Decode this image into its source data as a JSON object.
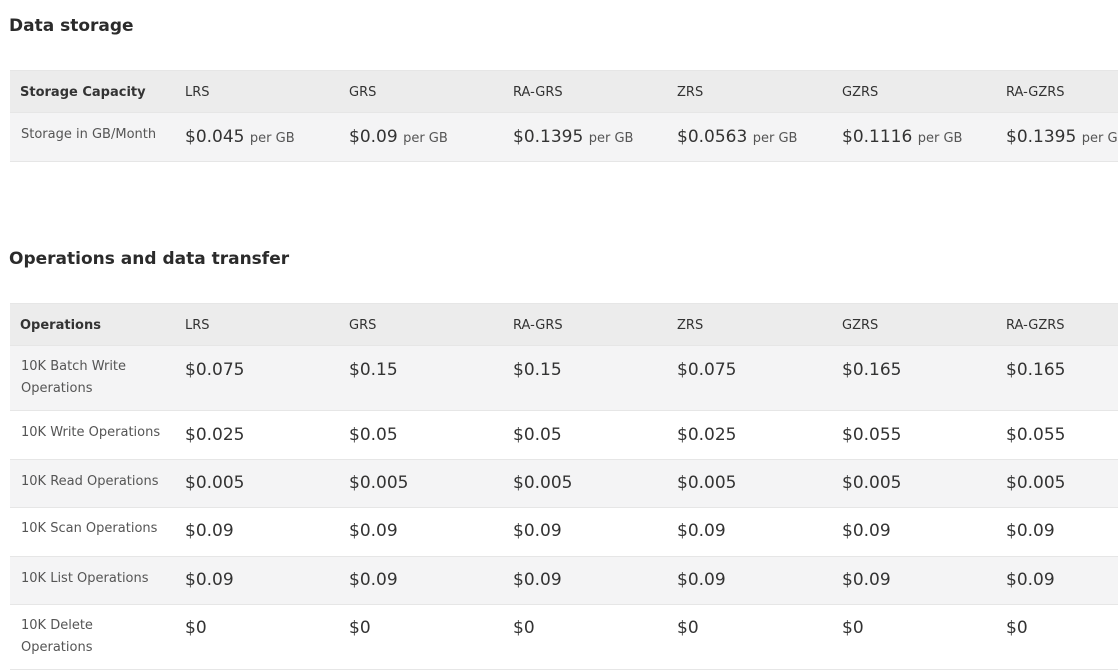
{
  "data_storage": {
    "title": "Data storage",
    "header": [
      "Storage Capacity",
      "LRS",
      "GRS",
      "RA-GRS",
      "ZRS",
      "GZRS",
      "RA-GZRS"
    ],
    "row": {
      "label": "Storage in GB/Month",
      "prices": [
        "$0.045",
        "$0.09",
        "$0.1395",
        "$0.0563",
        "$0.1116",
        "$0.1395"
      ],
      "unit": "per GB"
    }
  },
  "operations": {
    "title": "Operations and data transfer",
    "header": [
      "Operations",
      "LRS",
      "GRS",
      "RA-GRS",
      "ZRS",
      "GZRS",
      "RA-GZRS"
    ],
    "rows": [
      {
        "label": "10K Batch Write Operations",
        "values": [
          "$0.075",
          "$0.15",
          "$0.15",
          "$0.075",
          "$0.165",
          "$0.165"
        ]
      },
      {
        "label": "10K Write Operations",
        "values": [
          "$0.025",
          "$0.05",
          "$0.05",
          "$0.025",
          "$0.055",
          "$0.055"
        ]
      },
      {
        "label": "10K Read Operations",
        "values": [
          "$0.005",
          "$0.005",
          "$0.005",
          "$0.005",
          "$0.005",
          "$0.005"
        ]
      },
      {
        "label": "10K Scan Operations",
        "values": [
          "$0.09",
          "$0.09",
          "$0.09",
          "$0.09",
          "$0.09",
          "$0.09"
        ]
      },
      {
        "label": "10K List Operations",
        "values": [
          "$0.09",
          "$0.09",
          "$0.09",
          "$0.09",
          "$0.09",
          "$0.09"
        ]
      },
      {
        "label": "10K Delete Operations",
        "values": [
          "$0",
          "$0",
          "$0",
          "$0",
          "$0",
          "$0"
        ]
      }
    ]
  }
}
